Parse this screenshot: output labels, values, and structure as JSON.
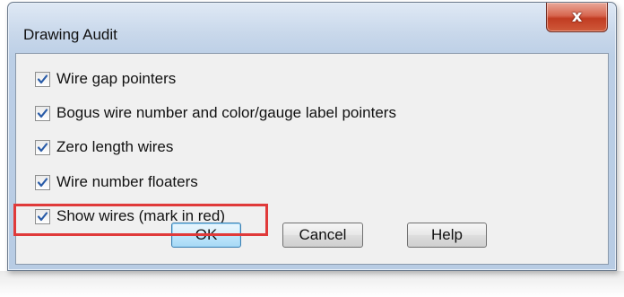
{
  "window": {
    "title": "Drawing Audit",
    "close_label": "x"
  },
  "options": [
    {
      "label": "Wire gap pointers",
      "checked": true
    },
    {
      "label": "Bogus wire number and color/gauge label pointers",
      "checked": true
    },
    {
      "label": "Zero length wires",
      "checked": true
    },
    {
      "label": "Wire number floaters",
      "checked": true
    },
    {
      "label": "Show wires (mark in red)",
      "checked": true
    }
  ],
  "buttons": {
    "ok": "OK",
    "cancel": "Cancel",
    "help": "Help"
  },
  "colors": {
    "highlight": "#e03a3a",
    "check": "#2a5ca8",
    "close_button": "#c13c22"
  },
  "icons": {
    "checkbox": "checkmark-icon",
    "close": "close-icon"
  }
}
